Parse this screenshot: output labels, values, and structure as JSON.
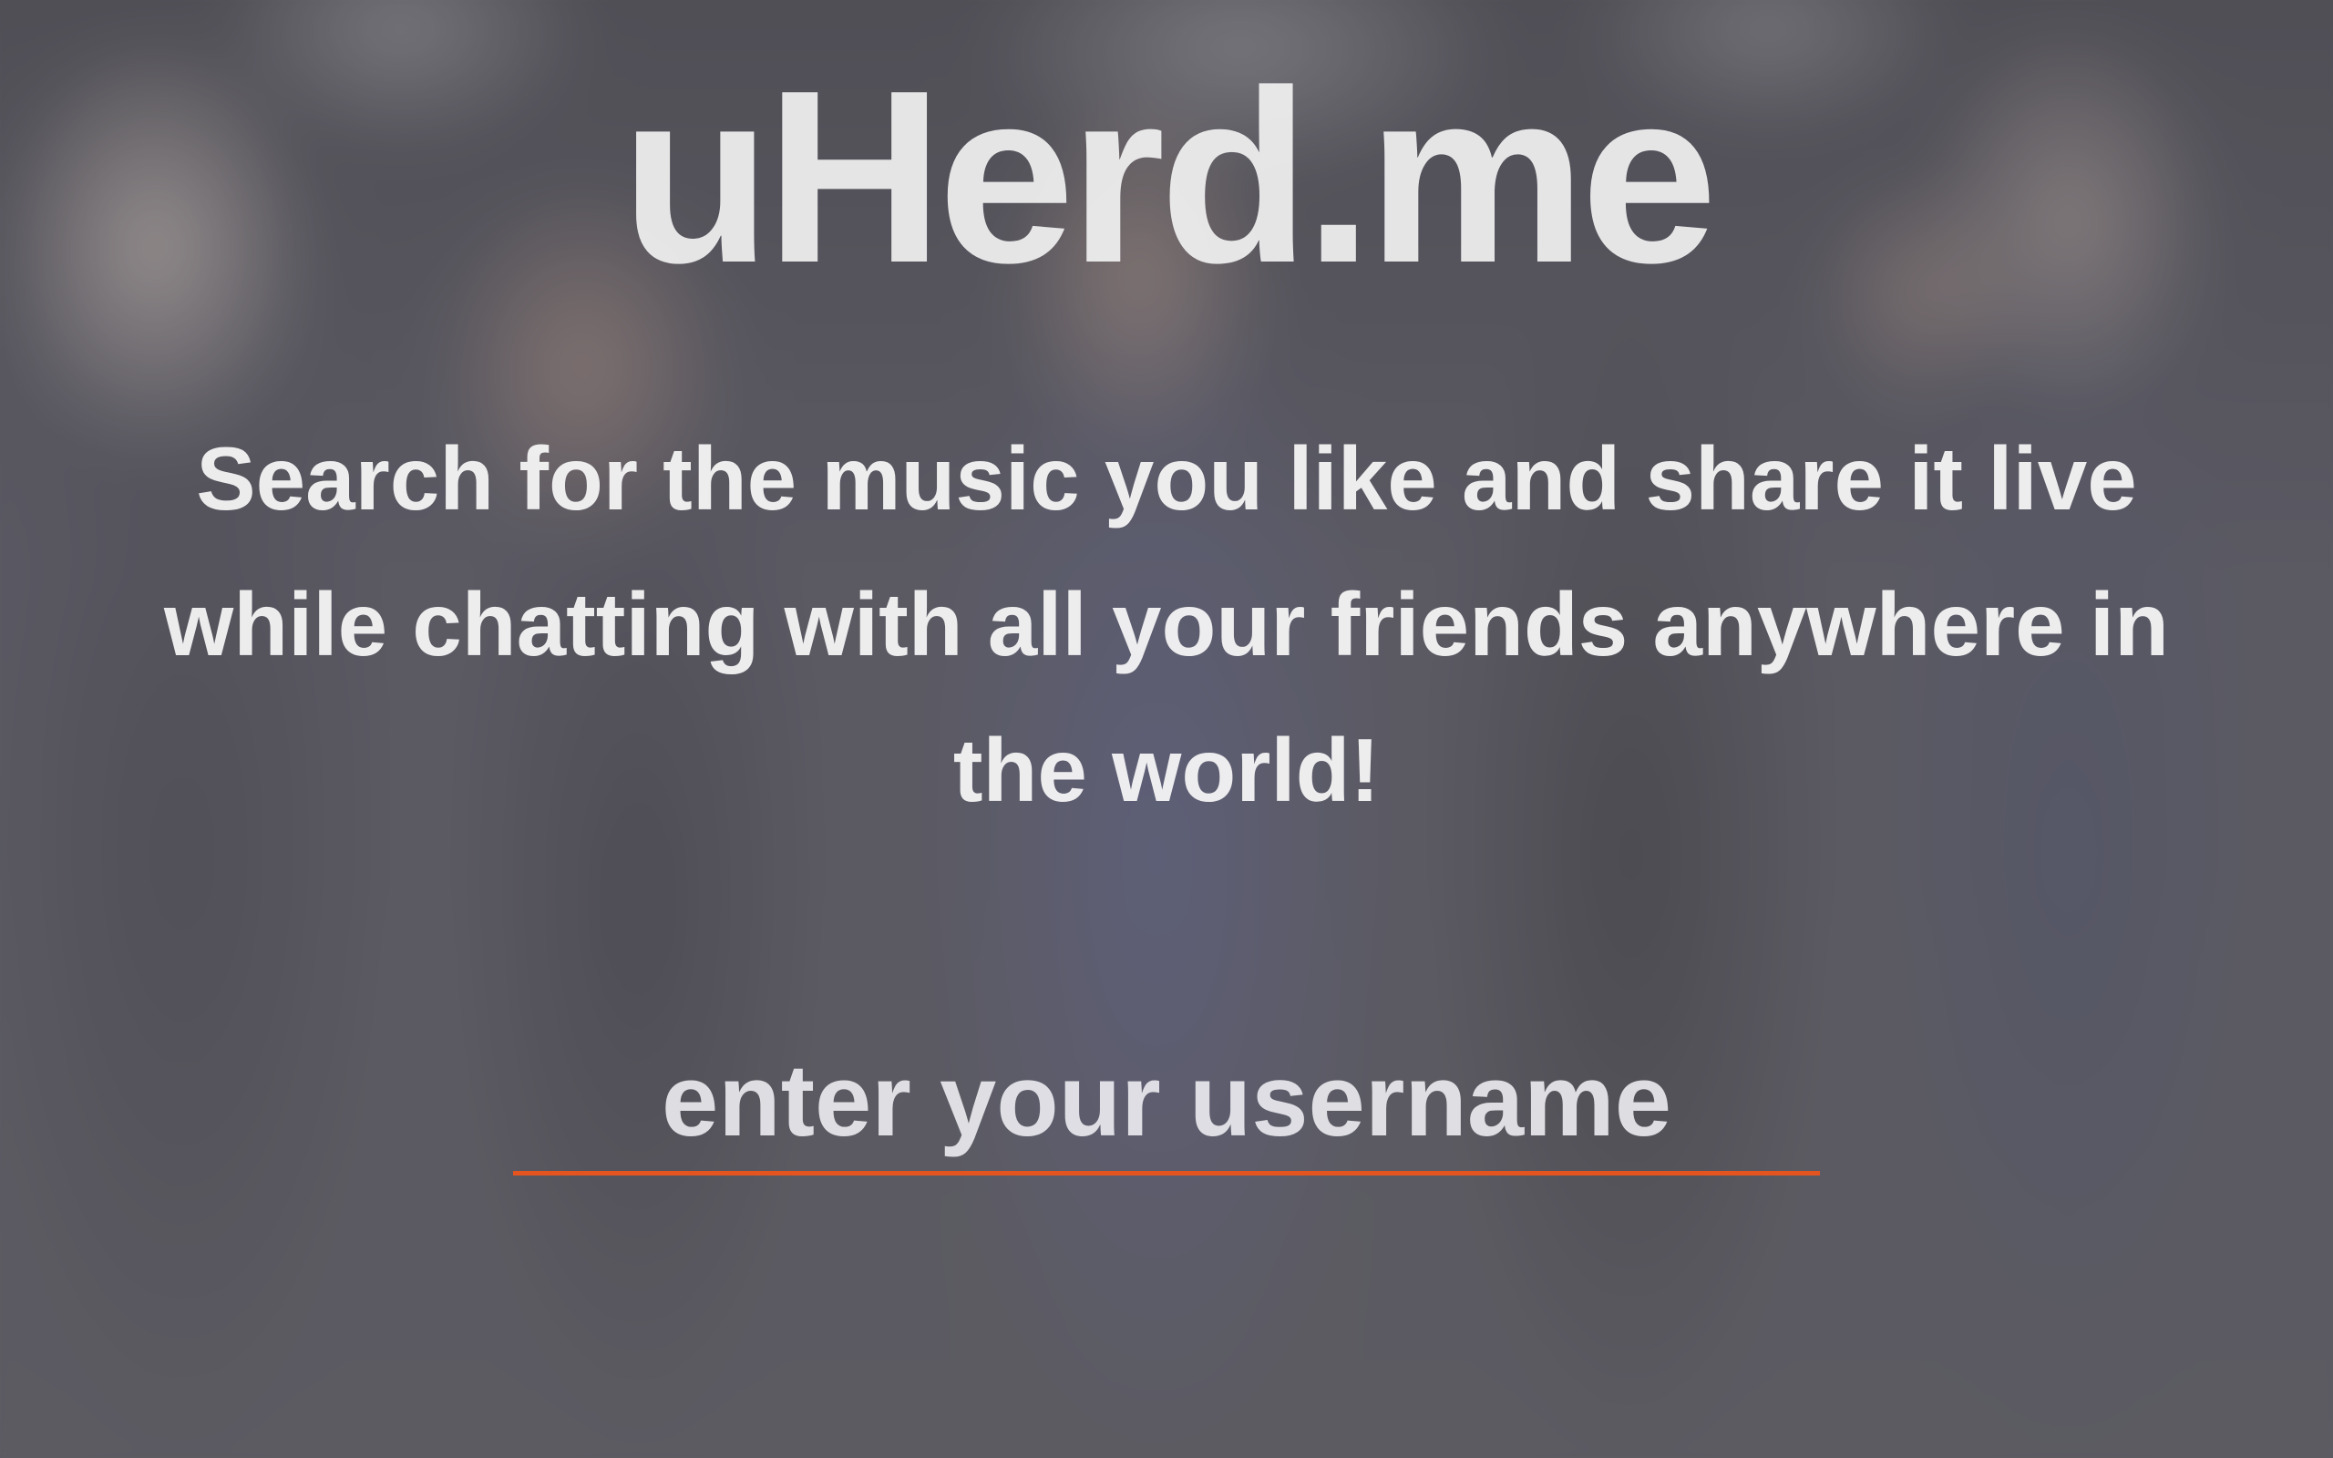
{
  "app": {
    "title": "uHerd.me",
    "tagline": "Search for the music you like and share it live while chatting with all your friends anywhere in the world!"
  },
  "login": {
    "username_placeholder": "enter your username",
    "username_value": ""
  },
  "colors": {
    "accent": "#e4541f",
    "text": "#f5f5f5"
  },
  "background": {
    "description_icon": "blurred-photo-background"
  }
}
